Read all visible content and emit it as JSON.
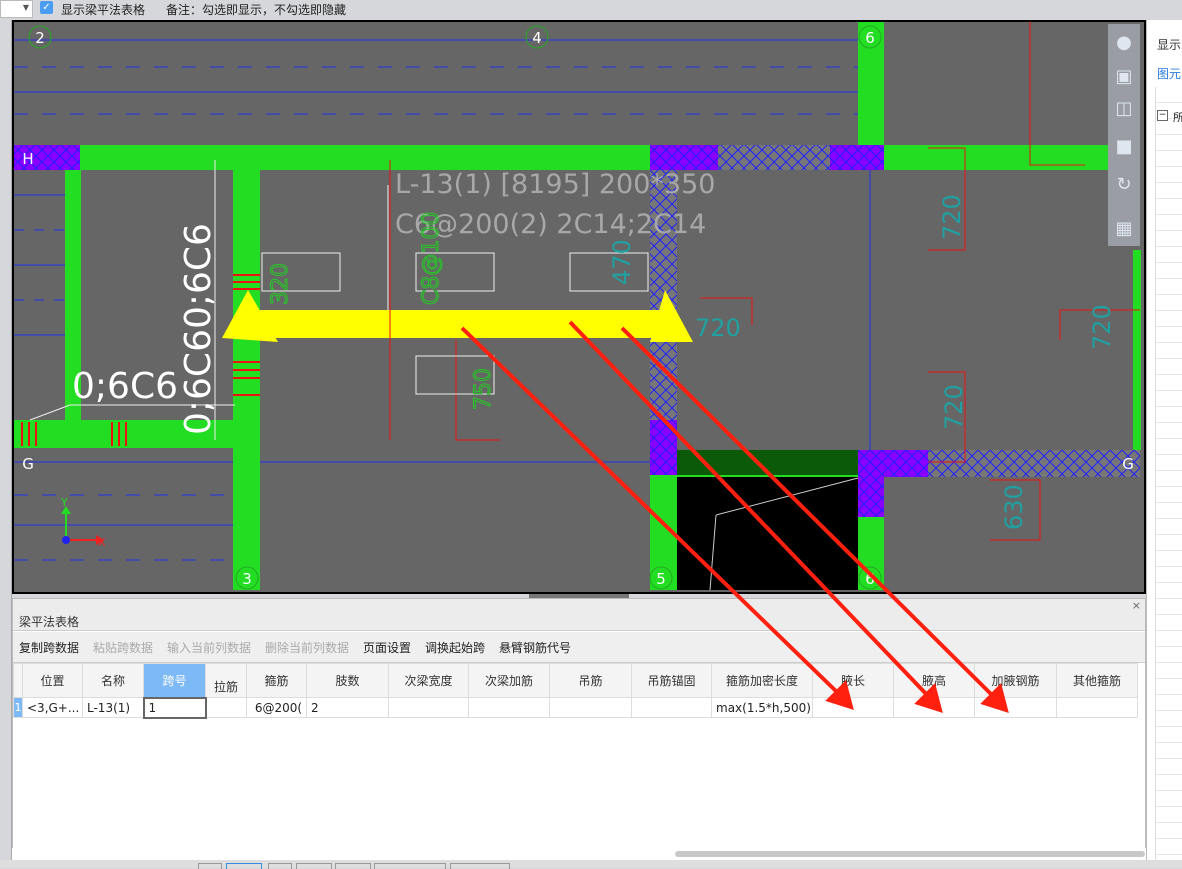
{
  "topbar": {
    "checkbox_label": "显示梁平法表格",
    "note": "备注：勾选即显示，不勾选即隐藏",
    "checked": true
  },
  "canvas": {
    "beam_label_line1": "L-13(1) [8195] 200*350",
    "beam_label_line2": "C6@200(2) 2C14;2C14",
    "stirrup_text_h": "0;6C6",
    "stirrup_text_v": "0;6C60;6C6",
    "axes": [
      "2",
      "4",
      "6",
      "3",
      "5",
      "6",
      "H",
      "G",
      "G"
    ],
    "dims": [
      "320",
      "C8@100",
      "470",
      "750",
      "720",
      "720",
      "720",
      "720",
      "630"
    ],
    "ucs": {
      "x": "X",
      "y": "Y"
    }
  },
  "right_panel": {
    "tab1": "显示",
    "tab2": "图元",
    "tree_root": "所"
  },
  "vtools": [
    "orbit-icon",
    "view-3d-icon",
    "wireframe-icon",
    "solid-icon",
    "rotate-icon",
    "settings-grid-icon"
  ],
  "panel": {
    "title": "梁平法表格",
    "toolbar": [
      {
        "label": "复制跨数据",
        "enabled": true
      },
      {
        "label": "粘贴跨数据",
        "enabled": false
      },
      {
        "label": "输入当前列数据",
        "enabled": false
      },
      {
        "label": "删除当前列数据",
        "enabled": false
      },
      {
        "label": "页面设置",
        "enabled": true
      },
      {
        "label": "调换起始跨",
        "enabled": true
      },
      {
        "label": "悬臂钢筋代号",
        "enabled": true
      }
    ],
    "columns": [
      "位置",
      "名称",
      "跨号",
      "拉筋",
      "箍筋",
      "肢数",
      "次梁宽度",
      "次梁加筋",
      "吊筋",
      "吊筋锚固",
      "箍筋加密长度",
      "腋长",
      "腋高",
      "加腋钢筋",
      "其他箍筋"
    ],
    "rows": [
      {
        "num": "1",
        "cells": [
          "<3,G+...",
          "L-13(1)",
          "1",
          "",
          " 6@200(",
          "2",
          "",
          "",
          "",
          "",
          "max(1.5*h,500)",
          "",
          "",
          "",
          ""
        ]
      }
    ]
  },
  "colors": {
    "wall": "#22dd22",
    "beam_selected": "#ffff00",
    "hatch": "#8a00ff",
    "arrow": "#ff2010",
    "canvas_bg": "#666666"
  }
}
